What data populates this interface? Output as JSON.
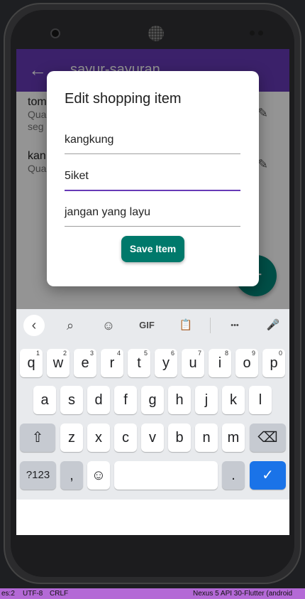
{
  "app_bar": {
    "title": "sayur-sayuran",
    "back_icon": "arrow-back-icon"
  },
  "list": {
    "items": [
      {
        "title": "tom",
        "line1": "Qua",
        "line2": "seg"
      },
      {
        "title": "kan",
        "line1": "Qua"
      }
    ]
  },
  "fab": {
    "icon": "add-icon",
    "label": "+"
  },
  "dialog": {
    "title": "Edit shopping item",
    "fields": [
      {
        "value": "kangkung"
      },
      {
        "value": "5iket"
      },
      {
        "value": "jangan yang layu"
      }
    ],
    "save_label": "Save Item"
  },
  "keyboard": {
    "toolbar": {
      "back": "‹",
      "search": "⌕",
      "sticker": "☺",
      "gif": "GIF",
      "clipboard": "📋",
      "more": "•••",
      "mic": "🎤"
    },
    "row1": [
      {
        "k": "q",
        "s": "1"
      },
      {
        "k": "w",
        "s": "2"
      },
      {
        "k": "e",
        "s": "3"
      },
      {
        "k": "r",
        "s": "4"
      },
      {
        "k": "t",
        "s": "5"
      },
      {
        "k": "y",
        "s": "6"
      },
      {
        "k": "u",
        "s": "7"
      },
      {
        "k": "i",
        "s": "8"
      },
      {
        "k": "o",
        "s": "9"
      },
      {
        "k": "p",
        "s": "0"
      }
    ],
    "row2": [
      "a",
      "s",
      "d",
      "f",
      "g",
      "h",
      "j",
      "k",
      "l"
    ],
    "row3": [
      "z",
      "x",
      "c",
      "v",
      "b",
      "n",
      "m"
    ],
    "shift": "⇧",
    "backspace": "⌫",
    "symbols": "?123",
    "comma": ",",
    "emoji": "☺",
    "period": ".",
    "enter": "✓"
  },
  "status_bar": {
    "left": "es:2",
    "encoding": "UTF-8",
    "line_ending": "CRLF",
    "right": "Nexus 5 API 30-Flutter (android"
  }
}
